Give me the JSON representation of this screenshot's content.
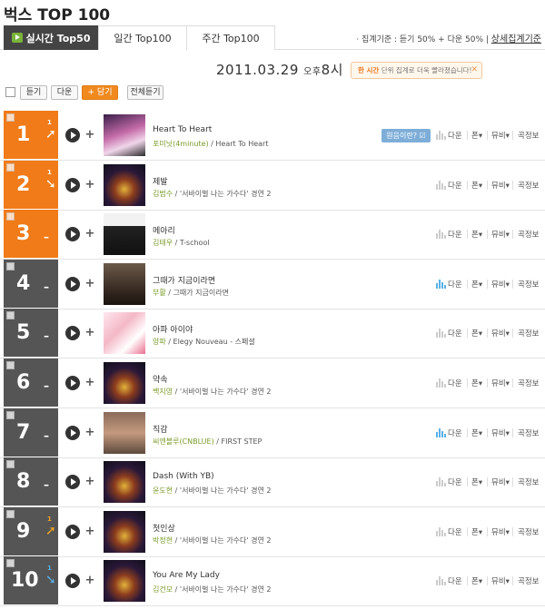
{
  "page": {
    "title": "벅스 TOP 100",
    "tabs": [
      {
        "label": "실시간 Top50",
        "active": true
      },
      {
        "label": "일간 Top100",
        "active": false
      },
      {
        "label": "주간 Top100",
        "active": false
      }
    ],
    "aggregation": "· 집계기준 : 듣기 50% + 다운 50%",
    "detail_link": "상세집계기준",
    "date": "2011.03.29",
    "ampm": "오후",
    "hour": "8시",
    "notice": {
      "bold": "한 시간",
      "rest": " 단위 집계로 더욱 빨라졌습니다!",
      "close": "✕"
    }
  },
  "controls": {
    "listen": "듣기",
    "download": "다운",
    "add": "+ 담기",
    "listen_all": "전체듣기"
  },
  "row_actions": {
    "download": "다운",
    "phone": "폰▾",
    "music_video": "뮤비▾",
    "song_info": "곡정보",
    "tooltip": "원음이란? ☑"
  },
  "colors": {
    "orange_rank": "#f07b18",
    "gray_rank": "#555555",
    "artist_green": "#7a9b2a",
    "up_gold": "#f5a623",
    "up_blue": "#58b1ea"
  },
  "songs": [
    {
      "rank": "1",
      "change": "up",
      "change_num": "1",
      "change_color": "white",
      "title": "Heart To Heart",
      "artist": "포미닛(4minute)",
      "album": " / Heart To Heart",
      "rank_style": "orange",
      "show_tip": true,
      "bars_on": false,
      "cover": "purple-group"
    },
    {
      "rank": "2",
      "change": "down",
      "change_num": "1",
      "change_color": "white",
      "title": "제발",
      "artist": "김범수",
      "album": " / '서바이벌 나는 가수다' 경연 2",
      "rank_style": "orange",
      "show_tip": false,
      "bars_on": false,
      "cover": "stage"
    },
    {
      "rank": "3",
      "change": "none",
      "change_num": "–",
      "change_color": "white",
      "title": "메아리",
      "artist": "김태우",
      "album": " / T-school",
      "rank_style": "orange",
      "show_tip": false,
      "bars_on": false,
      "cover": "bw-man"
    },
    {
      "rank": "4",
      "change": "none",
      "change_num": "–",
      "change_color": "white",
      "title": "그때가 지금이라면",
      "artist": "부활",
      "album": " / 그때가 지금이라면",
      "rank_style": "gray",
      "show_tip": false,
      "bars_on": true,
      "cover": "band"
    },
    {
      "rank": "5",
      "change": "none",
      "change_num": "–",
      "change_color": "white",
      "title": "아파 아이야",
      "artist": "양파",
      "album": " / Elegy Nouveau - 스페셜",
      "rank_style": "gray",
      "show_tip": false,
      "bars_on": false,
      "cover": "pink-woman"
    },
    {
      "rank": "6",
      "change": "none",
      "change_num": "–",
      "change_color": "white",
      "title": "약속",
      "artist": "백지영",
      "album": " / '서바이벌 나는 가수다' 경연 2",
      "rank_style": "gray",
      "show_tip": false,
      "bars_on": false,
      "cover": "stage"
    },
    {
      "rank": "7",
      "change": "none",
      "change_num": "–",
      "change_color": "white",
      "title": "직감",
      "artist": "씨엔블루(CNBLUE)",
      "album": " / FIRST STEP",
      "rank_style": "gray",
      "show_tip": false,
      "bars_on": true,
      "cover": "first-step"
    },
    {
      "rank": "8",
      "change": "none",
      "change_num": "–",
      "change_color": "white",
      "title": "Dash (With YB)",
      "artist": "윤도현",
      "album": " / '서바이벌 나는 가수다' 경연 2",
      "rank_style": "gray",
      "show_tip": false,
      "bars_on": false,
      "cover": "stage"
    },
    {
      "rank": "9",
      "change": "up",
      "change_num": "1",
      "change_color": "gold",
      "title": "첫인상",
      "artist": "박정현",
      "album": " / '서바이벌 나는 가수다' 경연 2",
      "rank_style": "gray",
      "show_tip": false,
      "bars_on": false,
      "cover": "stage"
    },
    {
      "rank": "10",
      "change": "down",
      "change_num": "1",
      "change_color": "blue",
      "title": "You Are My Lady",
      "artist": "김건모",
      "album": " / '서바이벌 나는 가수다' 경연 2",
      "rank_style": "gray",
      "show_tip": false,
      "bars_on": false,
      "cover": "stage"
    }
  ]
}
